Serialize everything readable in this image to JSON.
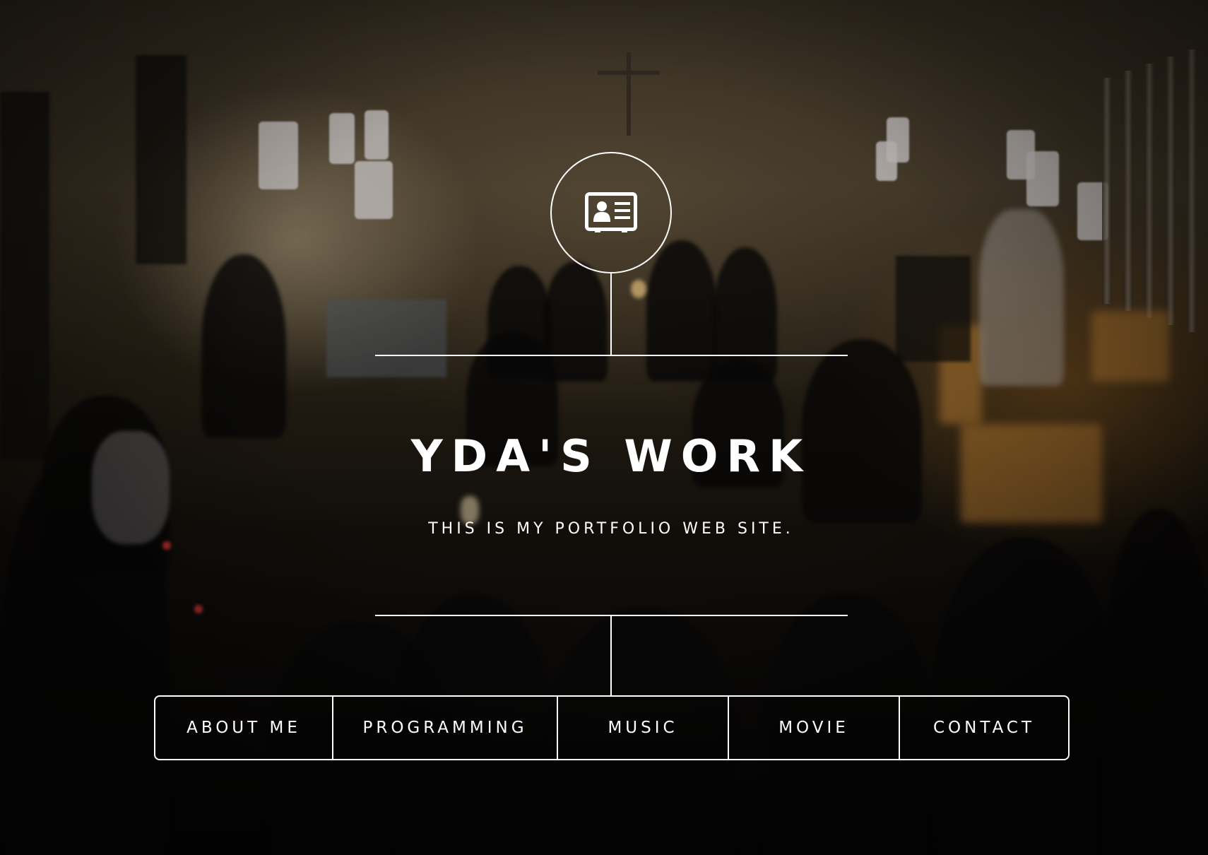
{
  "site": {
    "title": "YDA'S WORK",
    "subtitle": "THIS IS MY PORTFOLIO WEB SITE.",
    "logo_icon": "id-card-icon"
  },
  "nav": {
    "items": [
      {
        "label": "ABOUT ME"
      },
      {
        "label": "PROGRAMMING"
      },
      {
        "label": "MUSIC"
      },
      {
        "label": "MOVIE"
      },
      {
        "label": "CONTACT"
      }
    ]
  },
  "colors": {
    "foreground": "#ffffff",
    "background": "#0b0908"
  }
}
